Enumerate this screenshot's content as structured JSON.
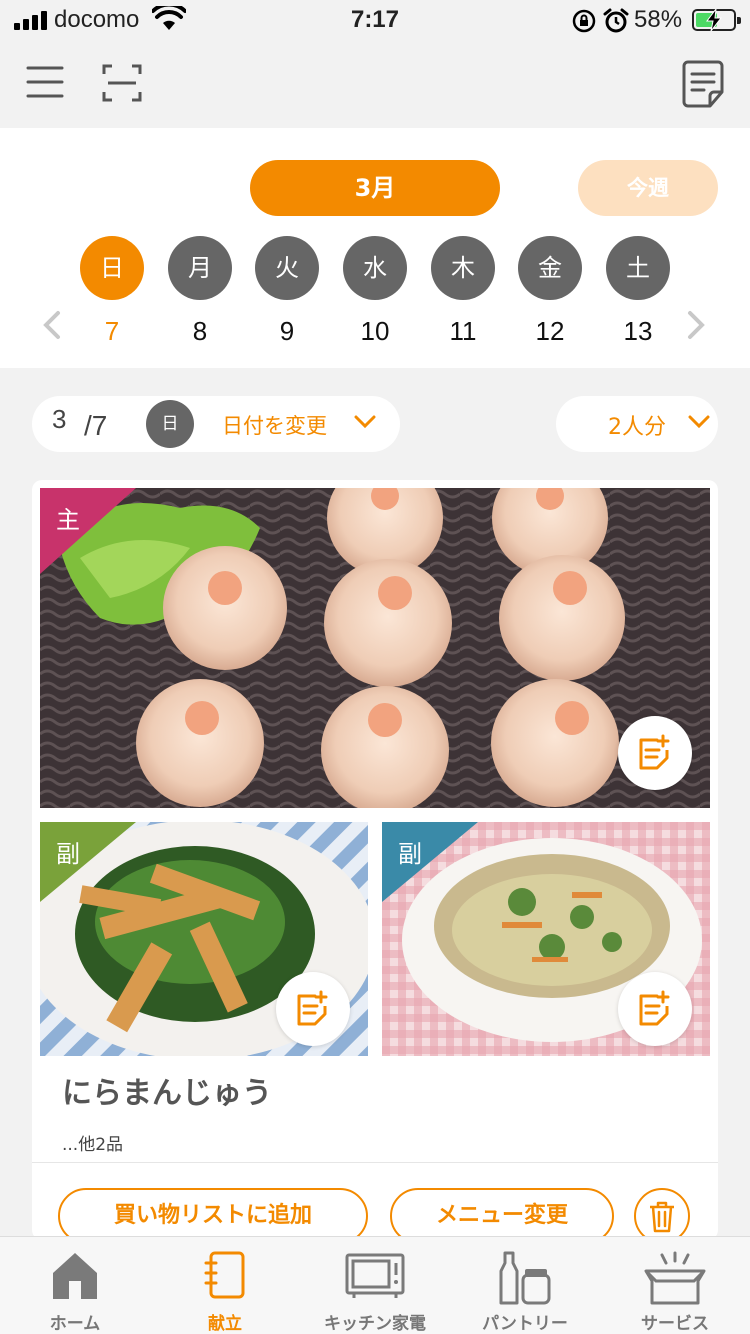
{
  "status_bar": {
    "carrier": "docomo",
    "time": "7:17",
    "battery_pct": "58%",
    "battery_level": 0.58,
    "icons": [
      "signal-icon",
      "wifi-icon",
      "orientation-lock-icon",
      "alarm-icon",
      "battery-charging-icon"
    ]
  },
  "top_nav": {
    "icons": [
      "hamburger-menu-icon",
      "scan-icon",
      "note-icon"
    ]
  },
  "calendar": {
    "month_label": "3月",
    "this_week_label": "今週",
    "days": [
      {
        "dow": "日",
        "date": "7",
        "selected": true
      },
      {
        "dow": "月",
        "date": "8"
      },
      {
        "dow": "火",
        "date": "9"
      },
      {
        "dow": "水",
        "date": "10"
      },
      {
        "dow": "木",
        "date": "11"
      },
      {
        "dow": "金",
        "date": "12"
      },
      {
        "dow": "土",
        "date": "13"
      }
    ]
  },
  "date_bar": {
    "month": "3",
    "day": "/7",
    "dow": "日",
    "change_label": "日付を変更",
    "servings": "2人分"
  },
  "menu": {
    "main_tag": "主",
    "side_tag_1": "副",
    "side_tag_2": "副",
    "title": "にらまんじゅう",
    "subtitle": "...他2品",
    "shopping_list_button": "買い物リストに追加",
    "change_menu_button": "メニュー変更"
  },
  "tabbar": {
    "tabs": [
      {
        "label": "ホーム",
        "icon": "home-icon"
      },
      {
        "label": "献立",
        "icon": "notebook-icon",
        "active": true
      },
      {
        "label": "キッチン家電",
        "icon": "microwave-icon"
      },
      {
        "label": "パントリー",
        "icon": "pantry-icon"
      },
      {
        "label": "サービス",
        "icon": "service-box-icon"
      }
    ]
  },
  "colors": {
    "accent": "#f38a00",
    "accent_light": "#fde0c0",
    "main_tag": "#c8336b",
    "side_tag_1": "#7aa23a",
    "side_tag_2": "#3a8aa8",
    "day_circle": "#666666"
  }
}
